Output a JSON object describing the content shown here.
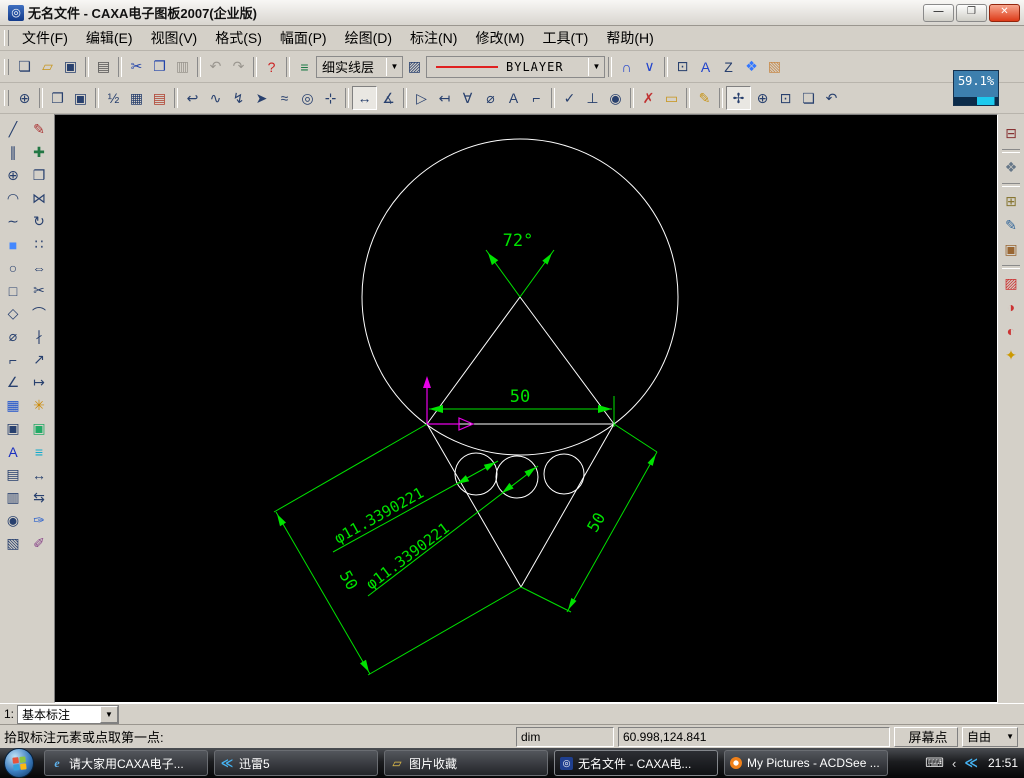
{
  "window": {
    "title": "无名文件 - CAXA电子图板2007(企业版)",
    "buttons": {
      "minimize": "—",
      "restore": "❐",
      "close": "✕"
    },
    "zoom_indicator": "59.1%"
  },
  "menu": {
    "items": [
      {
        "id": "file",
        "label": "文件(F)"
      },
      {
        "id": "edit",
        "label": "编辑(E)"
      },
      {
        "id": "view",
        "label": "视图(V)"
      },
      {
        "id": "format",
        "label": "格式(S)"
      },
      {
        "id": "sheet",
        "label": "幅面(P)"
      },
      {
        "id": "draw",
        "label": "绘图(D)"
      },
      {
        "id": "dimension",
        "label": "标注(N)"
      },
      {
        "id": "modify",
        "label": "修改(M)"
      },
      {
        "id": "tools",
        "label": "工具(T)"
      },
      {
        "id": "help",
        "label": "帮助(H)"
      }
    ]
  },
  "toolbar_standard": {
    "groups_left": [
      [
        {
          "id": "new",
          "g": "❏",
          "c": "#28406e"
        },
        {
          "id": "open",
          "g": "▱",
          "c": "#c79418"
        },
        {
          "id": "save",
          "g": "▣",
          "c": "#28406e"
        }
      ],
      [
        {
          "id": "print",
          "g": "▤",
          "c": "#555555"
        }
      ],
      [
        {
          "id": "cut",
          "g": "✂",
          "c": "#2244aa"
        },
        {
          "id": "copy",
          "g": "❐",
          "c": "#2244aa"
        },
        {
          "id": "paste",
          "g": "▥",
          "disabled": true
        }
      ],
      [
        {
          "id": "undo",
          "g": "↶",
          "disabled": true
        },
        {
          "id": "redo",
          "g": "↷",
          "disabled": true
        }
      ],
      [
        {
          "id": "help",
          "g": "?",
          "c": "#cc2222"
        }
      ]
    ],
    "layers_button": {
      "id": "layers",
      "g": "≡",
      "c": "#1d7a46"
    },
    "layer_combo_value": "细实线层",
    "linetype_button": {
      "id": "linetype",
      "g": "▨",
      "c": "#28406e"
    },
    "color_combo_value": "BYLAYER",
    "groups_right": [
      [
        {
          "id": "ortho-snap",
          "g": "∩",
          "c": "#2244cc"
        },
        {
          "id": "guide-snap",
          "g": "∨",
          "c": "#2244cc"
        }
      ],
      [
        {
          "id": "window-select",
          "g": "⊡",
          "c": "#28406e"
        },
        {
          "id": "annotation-align",
          "g": "A",
          "c": "#2244cc"
        },
        {
          "id": "sketch-order",
          "g": "Z",
          "c": "#28406e"
        },
        {
          "id": "pattern-array",
          "g": "❖",
          "c": "#3377ff"
        },
        {
          "id": "page-preview",
          "g": "▧",
          "c": "#c78a4a"
        }
      ]
    ]
  },
  "toolbar_view": {
    "groups": [
      [
        {
          "id": "show-all",
          "g": "⊕"
        }
      ],
      [
        {
          "id": "redraw",
          "g": "❐"
        },
        {
          "id": "text-frame",
          "g": "▣"
        }
      ],
      [
        {
          "id": "fraction-text",
          "g": "½"
        },
        {
          "id": "table",
          "g": "▦"
        },
        {
          "id": "report",
          "g": "▤",
          "c": "#b04030"
        }
      ],
      [
        {
          "id": "hook-line",
          "g": "↩"
        },
        {
          "id": "wave-line",
          "g": "∿"
        },
        {
          "id": "zigzag-line",
          "g": "↯"
        },
        {
          "id": "pointer",
          "g": "➤"
        },
        {
          "id": "freehand",
          "g": "≈"
        },
        {
          "id": "circle-ref",
          "g": "◎"
        },
        {
          "id": "center-mark",
          "g": "⊹"
        }
      ],
      [
        {
          "id": "dimension",
          "g": "↔",
          "pressed": true
        },
        {
          "id": "angle-dimension",
          "g": "∡"
        }
      ],
      [
        {
          "id": "datum-dimension",
          "g": "▷"
        },
        {
          "id": "baseline-dimension",
          "g": "↤"
        },
        {
          "id": "tolerance",
          "g": "∀"
        },
        {
          "id": "diameter-dimension",
          "g": "⌀"
        },
        {
          "id": "text-note",
          "g": "A"
        },
        {
          "id": "corner-note",
          "g": "⌐"
        }
      ],
      [
        {
          "id": "roughness",
          "g": "✓"
        },
        {
          "id": "datum-target",
          "g": "⊥"
        },
        {
          "id": "weld-symbol",
          "g": "◉"
        }
      ],
      [
        {
          "id": "pick-delete",
          "g": "✗",
          "c": "#c03030"
        },
        {
          "id": "measure",
          "g": "▭",
          "c": "#c79418"
        }
      ],
      [
        {
          "id": "sketch-pencil",
          "g": "✎",
          "c": "#c79418"
        }
      ],
      [
        {
          "id": "pan",
          "g": "✢",
          "pressed": true
        },
        {
          "id": "zoom-dynamic",
          "g": "⊕"
        },
        {
          "id": "zoom-window",
          "g": "⊡"
        },
        {
          "id": "zoom-page",
          "g": "❏"
        },
        {
          "id": "zoom-previous",
          "g": "↶"
        }
      ]
    ]
  },
  "left_toolbar": {
    "col1": [
      {
        "id": "line",
        "g": "╱"
      },
      {
        "id": "parallel-line",
        "g": "∥"
      },
      {
        "id": "circle",
        "g": "⊕"
      },
      {
        "id": "arc",
        "g": "◠"
      },
      {
        "id": "spline",
        "g": "∼"
      },
      {
        "id": "formula-curve",
        "g": "■",
        "c": "#4488ff"
      },
      {
        "id": "ellipse",
        "g": "○"
      },
      {
        "id": "rectangle",
        "g": "□"
      },
      {
        "id": "polygon",
        "g": "◇"
      },
      {
        "id": "hatch",
        "g": "⌀"
      },
      {
        "id": "polyline",
        "g": "⌐"
      },
      {
        "id": "guideline",
        "g": "∠"
      },
      {
        "id": "grid-fill",
        "g": "▦",
        "c": "#2255cc"
      },
      {
        "id": "ole-object",
        "g": "▣"
      },
      {
        "id": "text",
        "g": "A",
        "c": "#1a2fbf"
      },
      {
        "id": "block",
        "g": "▤"
      },
      {
        "id": "block-insert",
        "g": "▥"
      },
      {
        "id": "library-search",
        "g": "◉"
      },
      {
        "id": "symbol-library",
        "g": "▧"
      }
    ],
    "col2": [
      {
        "id": "delete",
        "g": "✎",
        "c": "#aa3333"
      },
      {
        "id": "move",
        "g": "✚",
        "c": "#227744"
      },
      {
        "id": "copy-object",
        "g": "❐"
      },
      {
        "id": "mirror",
        "g": "⋈"
      },
      {
        "id": "rotate",
        "g": "↻"
      },
      {
        "id": "array",
        "g": "∷"
      },
      {
        "id": "offset",
        "g": "⇔"
      },
      {
        "id": "trim",
        "g": "✂"
      },
      {
        "id": "fillet",
        "g": "⌒"
      },
      {
        "id": "break",
        "g": "∤"
      },
      {
        "id": "extend",
        "g": "↗"
      },
      {
        "id": "stretch",
        "g": "↦"
      },
      {
        "id": "explode",
        "g": "✳",
        "c": "#cc8800"
      },
      {
        "id": "block-op",
        "g": "▣",
        "c": "#22aa66"
      },
      {
        "id": "layer-move",
        "g": "≡",
        "c": "#11aacc"
      },
      {
        "id": "dimension-tool",
        "g": "↔"
      },
      {
        "id": "dimension-edit",
        "g": "⇆"
      },
      {
        "id": "match-properties",
        "g": "✑",
        "c": "#3366cc"
      },
      {
        "id": "property-brush",
        "g": "✐",
        "c": "#884488"
      }
    ]
  },
  "right_toolbar": {
    "groups": [
      [
        {
          "id": "block-disassemble",
          "g": "⊟",
          "c": "#883333"
        }
      ],
      [
        {
          "id": "solid-3d",
          "g": "❖",
          "c": "#667788"
        }
      ],
      [
        {
          "id": "paste-special",
          "g": "⊞",
          "c": "#887733"
        },
        {
          "id": "image-edit",
          "g": "✎",
          "c": "#336699"
        },
        {
          "id": "sheet-edit",
          "g": "▣",
          "c": "#996633"
        }
      ],
      [
        {
          "id": "section-view",
          "g": "▨",
          "c": "#cc3333"
        },
        {
          "id": "detail-view",
          "g": "◑",
          "c": "#cc3333"
        },
        {
          "id": "partial-view",
          "g": "◐",
          "c": "#cc3333"
        },
        {
          "id": "block-create",
          "g": "✦",
          "c": "#cc9900"
        }
      ]
    ]
  },
  "canvas": {
    "dim_angle": "72°",
    "dim_width": "50",
    "dim_dia1": "φ11.3390221",
    "dim_dia2": "φ11.3390221",
    "dim_side_left": "50",
    "dim_side_right": "50",
    "colors": {
      "geometry": "#ffffff",
      "dimension": "#00e300",
      "cursor_marker": "#e800e8"
    }
  },
  "prompt_row": {
    "label": "1:",
    "combo_value": "基本标注"
  },
  "status_bar": {
    "prompt": "拾取标注元素或点取第一点:",
    "command": "dim",
    "coordinates": "60.998,124.841",
    "point_mode": "屏幕点",
    "snap_mode": "自由"
  },
  "taskbar": {
    "tasks": [
      {
        "id": "ie-caxa-page",
        "label": "请大家用CAXA电子...",
        "icon": "ie",
        "active": false
      },
      {
        "id": "thunder5",
        "label": "迅雷5",
        "icon": "thunder",
        "active": false
      },
      {
        "id": "pictures-folder",
        "label": "图片收藏",
        "icon": "folder",
        "active": false
      },
      {
        "id": "caxa-file",
        "label": "无名文件 - CAXA电...",
        "icon": "caxa",
        "active": true
      },
      {
        "id": "acdsee",
        "label": "My Pictures - ACDSee ...",
        "icon": "acdsee",
        "active": false
      }
    ],
    "tray": {
      "keyboard": "⌨",
      "collapse_arrow": "‹",
      "thunder": "≪",
      "time": "21:51"
    }
  }
}
